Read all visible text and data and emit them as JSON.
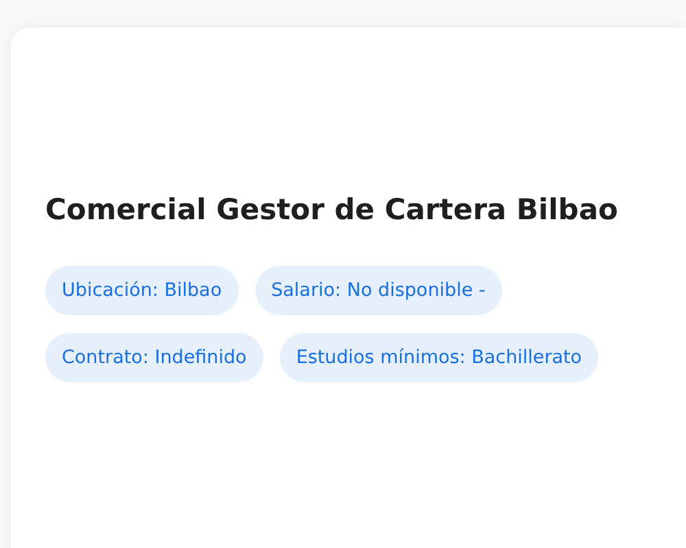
{
  "job": {
    "title": "Comercial Gestor de Cartera Bilbao",
    "tags": [
      {
        "label": "Ubicación: Bilbao"
      },
      {
        "label": "Salario: No disponible -"
      },
      {
        "label": "Contrato: Indefinido"
      },
      {
        "label": "Estudios mínimos: Bachillerato"
      }
    ]
  }
}
